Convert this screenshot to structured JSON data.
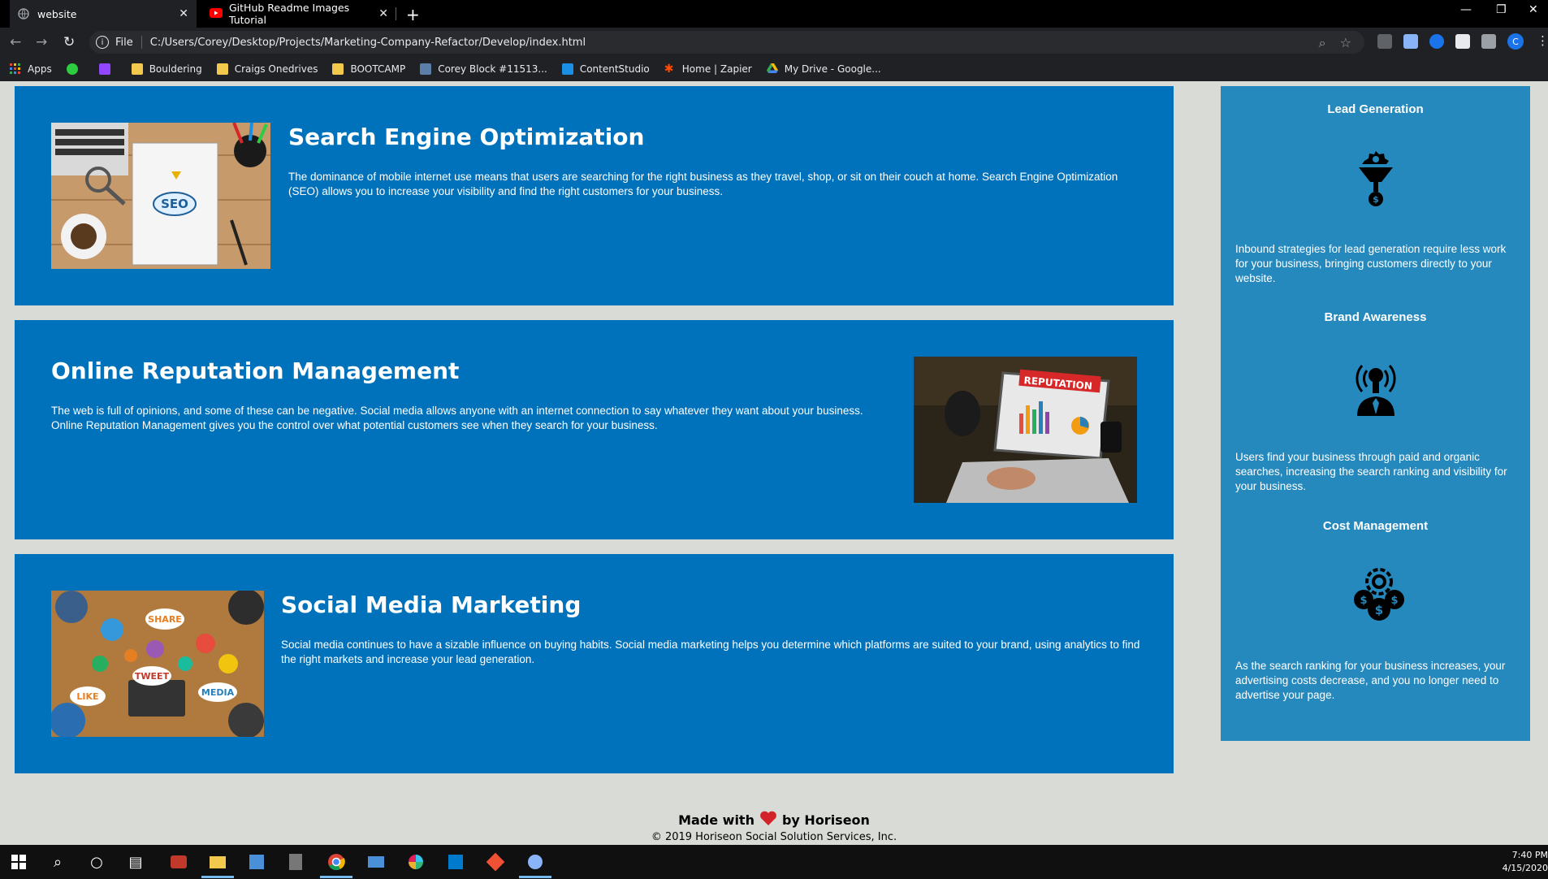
{
  "browser": {
    "tabs": [
      {
        "title": "website",
        "active": true
      },
      {
        "title": "GitHub Readme Images Tutorial",
        "active": false
      }
    ],
    "file_label": "File",
    "url": "C:/Users/Corey/Desktop/Projects/Marketing-Company-Refactor/Develop/index.html",
    "profile_initial": "C",
    "bookmarks": [
      {
        "label": "Apps",
        "icon": "apps-grid-icon"
      },
      {
        "label": "",
        "icon": "green-bookmark-icon"
      },
      {
        "label": "",
        "icon": "twitch-icon"
      },
      {
        "label": "Bouldering",
        "icon": "folder-icon"
      },
      {
        "label": "Craigs Onedrives",
        "icon": "folder-icon"
      },
      {
        "label": "BOOTCAMP",
        "icon": "folder-icon"
      },
      {
        "label": "Corey Block #11513...",
        "icon": "climber-icon"
      },
      {
        "label": "ContentStudio",
        "icon": "contentstudio-icon"
      },
      {
        "label": "Home | Zapier",
        "icon": "zapier-icon"
      },
      {
        "label": "My Drive - Google...",
        "icon": "google-drive-icon"
      }
    ]
  },
  "content": [
    {
      "title": "Search Engine Optimization",
      "text": "The dominance of mobile internet use means that users are searching for the right business as they travel, shop, or sit on their couch at home. Search Engine Optimization (SEO) allows you to increase your visibility and find the right customers for your business.",
      "image_label": "SEO"
    },
    {
      "title": "Online Reputation Management",
      "text": "The web is full of opinions, and some of these can be negative. Social media allows anyone with an internet connection to say whatever they want about your business. Online Reputation Management gives you the control over what potential customers see when they search for your business.",
      "image_label": "REPUTATION"
    },
    {
      "title": "Social Media Marketing",
      "text": "Social media continues to have a sizable influence on buying habits. Social media marketing helps you determine which platforms are suited to your brand, using analytics to find the right markets and increase your lead generation.",
      "image_labels": [
        "SHARE",
        "TWEET",
        "LIKE",
        "MEDIA"
      ]
    }
  ],
  "benefits": [
    {
      "title": "Lead Generation",
      "icon": "lead-generation-icon",
      "text": "Inbound strategies for lead generation require less work for your business, bringing customers directly to your website."
    },
    {
      "title": "Brand Awareness",
      "icon": "brand-awareness-icon",
      "text": "Users find your business through paid and organic searches, increasing the search ranking and visibility for your business."
    },
    {
      "title": "Cost Management",
      "icon": "cost-management-icon",
      "text": "As the search ranking for your business increases, your advertising costs decrease, and you no longer need to advertise your page."
    }
  ],
  "footer": {
    "made_with": "Made with",
    "by": "by Horiseon",
    "copyright": "© 2019 Horiseon Social Solution Services, Inc."
  },
  "taskbar": {
    "time": "7:40 PM",
    "date": "4/15/2020"
  },
  "colors": {
    "card_blue": "#0072bb",
    "sidebar_blue": "#2589bd",
    "page_bg": "#d9dcd6",
    "heart": "#d2232a"
  }
}
